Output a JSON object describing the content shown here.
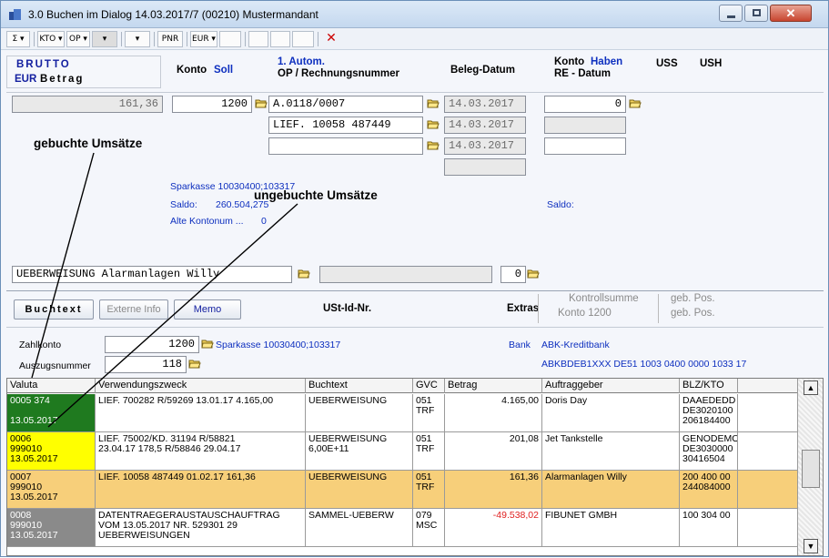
{
  "window": {
    "title": "3.0  Buchen im Dialog 14.03.2017/7 (00210) Mustermandant"
  },
  "toolbar": {
    "buttons": [
      "Σ ▾",
      "KTO ▾",
      "OP ▾",
      "▾",
      "▾",
      "PNR",
      "EUR ▾",
      "",
      "",
      "",
      "",
      "✕"
    ]
  },
  "header": {
    "brutto": "BRUTTO",
    "eur": "EUR",
    "betrag": "Betrag",
    "konto": "Konto",
    "soll": "Soll",
    "autom": "1. Autom.",
    "op_rechnung": "OP / Rechnungsnummer",
    "beleg_datum": "Beleg-Datum",
    "konto2": "Konto",
    "haben": "Haben",
    "re_datum": "RE - Datum",
    "uss": "USS",
    "ush": "USH"
  },
  "entry": {
    "betrag": "161,36",
    "konto_soll": "1200",
    "op_lines": [
      "A.0118/0007",
      "LIEF. 10058 487449",
      ""
    ],
    "beleg_daten": [
      "14.03.2017",
      "14.03.2017",
      "14.03.2017"
    ],
    "konto_haben": "0"
  },
  "info": {
    "sparkasse": "Sparkasse 10030400;103317",
    "saldo_label": "Saldo:",
    "saldo_value": "260.504,275",
    "alte_konto": "Alte Kontonum ...",
    "alte_konto_value": "0",
    "saldo_right": "Saldo:"
  },
  "annotations": {
    "gebuchte": "gebuchte Umsätze",
    "ungebuchte": "ungebuchte Umsätze"
  },
  "buchtext": {
    "value": "UEBERWEISUNG Alarmanlagen Willy",
    "right_value": "0"
  },
  "tabs": {
    "buchtext": "Buchtext",
    "externe": "Externe Info",
    "memo": "Memo",
    "ustid": "USt-Id-Nr.",
    "extras": "Extras",
    "kontrollsumme": "Kontrollsumme",
    "konto1200": "Konto 1200",
    "gebpos1": "geb. Pos.",
    "gebpos2": "geb. Pos."
  },
  "zahl": {
    "zahlkonto_label": "Zahlkonto",
    "zahlkonto_value": "1200",
    "auszug_label": "Auszugsnummer",
    "auszug_value": "118",
    "sparkasse": "Sparkasse 10030400;103317",
    "bank_label": "Bank",
    "bank_value": "ABK-Kreditbank",
    "iban": "ABKBDEB1XXX  DE51 1003 0400 0000 1033 17"
  },
  "grid": {
    "columns": [
      "Valuta",
      "Verwendungszweck",
      "Buchtext",
      "GVC",
      "Betrag",
      "Auftraggeber",
      "BLZ/KTO"
    ],
    "rows": [
      {
        "valuta": "0005  374\n\n13.05.2017",
        "zweck": "LIEF. 700282 R/59269        13.01.17 4.165,00",
        "buchtext": "UEBERWEISUNG",
        "gvc": "051\nTRF",
        "betrag": "4.165,00",
        "auftraggeber": "Doris Day",
        "blz": "DAAEDEDD\nDE3020100\n206184400"
      },
      {
        "valuta": "0006\n999010\n13.05.2017",
        "zweck": "LIEF. 75002/KD. 31194 R/58821\n23.04.17 178,5 R/58846          29.04.17",
        "buchtext": "UEBERWEISUNG\n6,00E+11",
        "gvc": "051\nTRF",
        "betrag": "201,08",
        "auftraggeber": "Jet Tankstelle",
        "blz": "GENODEMO\nDE3030000\n30416504"
      },
      {
        "valuta": "0007\n999010\n13.05.2017",
        "zweck": "LIEF. 10058 487449     01.02.17 161,36",
        "buchtext": "UEBERWEISUNG",
        "gvc": "051\nTRF",
        "betrag": "161,36",
        "auftraggeber": "Alarmanlagen Willy",
        "blz": "200 400 00\n244084000"
      },
      {
        "valuta": "0008\n999010\n13.05.2017",
        "zweck": "DATENTRAEGERAUSTAUSCHAUFTRAG\nVOM  13.05.2017 NR. 529301 29\nUEBERWEISUNGEN",
        "buchtext": "SAMMEL-UEBERW",
        "gvc": "079\nMSC",
        "betrag": "-49.538,02",
        "auftraggeber": "FIBUNET GMBH",
        "blz": "100 304 00"
      }
    ]
  },
  "colors": {
    "row1": "#1f7a1f",
    "row2": "#ffff00",
    "row3": "#f7cf7a",
    "row4": "#8a8a8a",
    "negative": "#e02020"
  }
}
